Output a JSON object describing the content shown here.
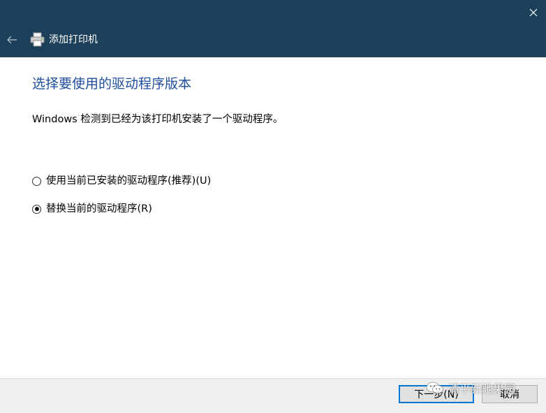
{
  "window": {
    "title": "添加打印机",
    "accent": "#1c4059",
    "close_icon": "close-icon",
    "back_icon": "back-arrow-icon",
    "app_icon": "printer-icon"
  },
  "page": {
    "heading": "选择要使用的驱动程序版本",
    "description": "Windows 检测到已经为该打印机安装了一个驱动程序。"
  },
  "options": [
    {
      "label": "使用当前已安装的驱动程序(推荐)(U)",
      "selected": false
    },
    {
      "label": "替换当前的驱动程序(R)",
      "selected": true
    }
  ],
  "footer": {
    "next_label": "下一步(N)",
    "cancel_label": "取消"
  },
  "watermark": {
    "text": "清平新驰果园",
    "icon": "wechat-icon"
  }
}
